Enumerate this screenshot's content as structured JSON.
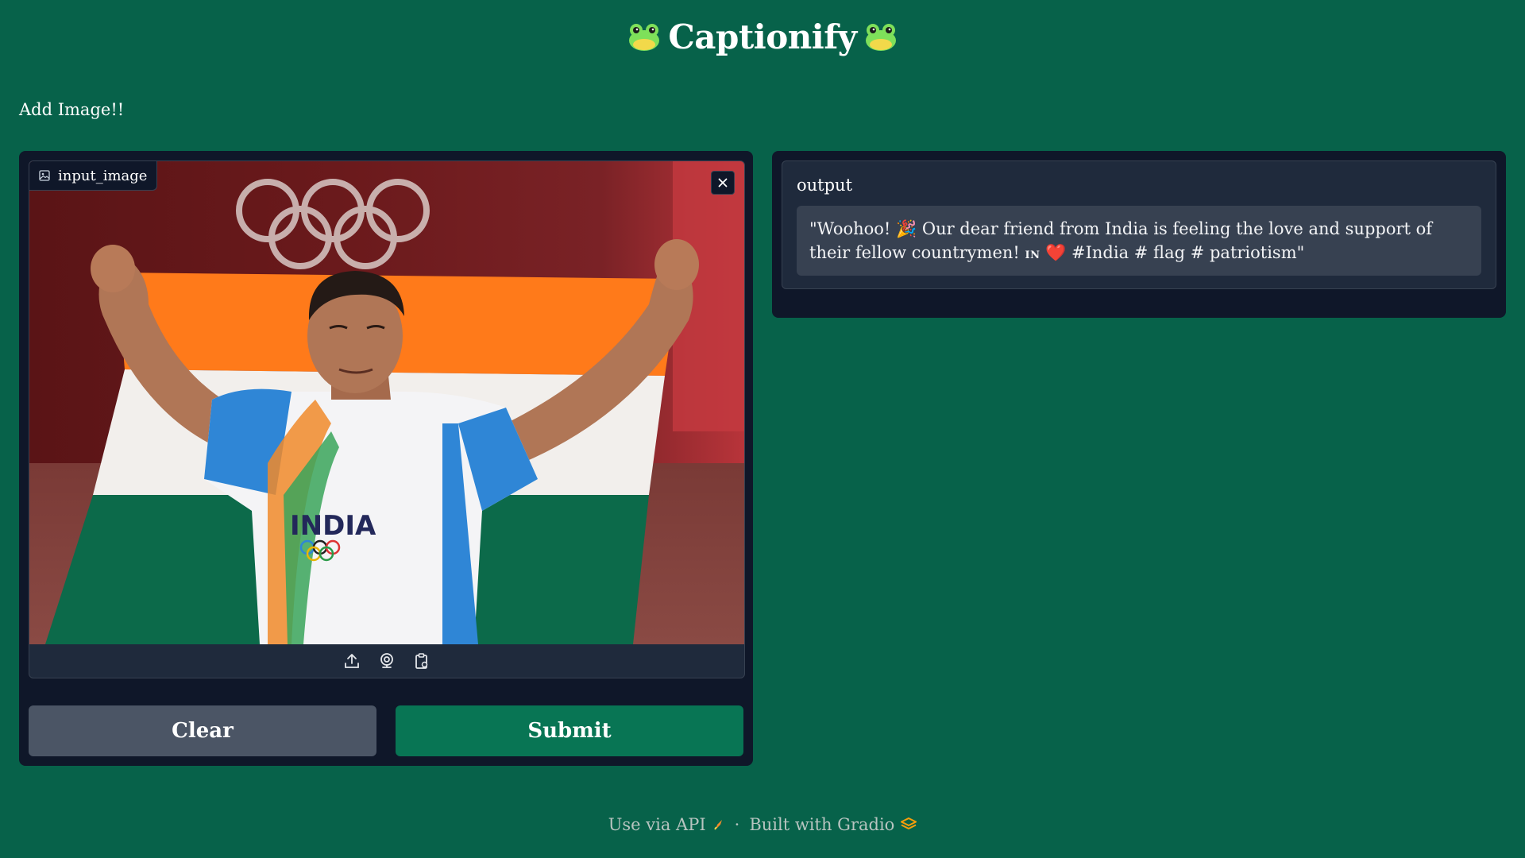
{
  "app": {
    "title": "Captionify",
    "title_icon": "frog-face-icon",
    "description": "Add Image!!"
  },
  "input": {
    "label": "input_image",
    "label_icon": "image-icon",
    "close_icon": "close-icon",
    "photo_alt": "Athlete in India team shirt holding Indian flag, Olympic rings in background",
    "toolbar_icons": [
      "upload-icon",
      "webcam-icon",
      "clipboard-icon"
    ]
  },
  "buttons": {
    "clear_label": "Clear",
    "submit_label": "Submit"
  },
  "output": {
    "label": "output",
    "text_part1": "\"Woohoo! 🎉 Our dear friend from India is feeling the love and support of their fellow countrymen! ",
    "flag_text": "IN",
    "heart": "❤️",
    "text_part2": " #India # flag # patriotism\""
  },
  "footer": {
    "api_label": "Use via API",
    "api_icon": "rocket-icon",
    "separator": "·",
    "built_label": "Built with Gradio",
    "gradio_icon": "gradio-logo-icon"
  },
  "colors": {
    "background": "#07624a",
    "panel": "#0f1729",
    "block": "#1f2a3c",
    "clear_button": "#4b5565",
    "submit_button": "#087554"
  }
}
